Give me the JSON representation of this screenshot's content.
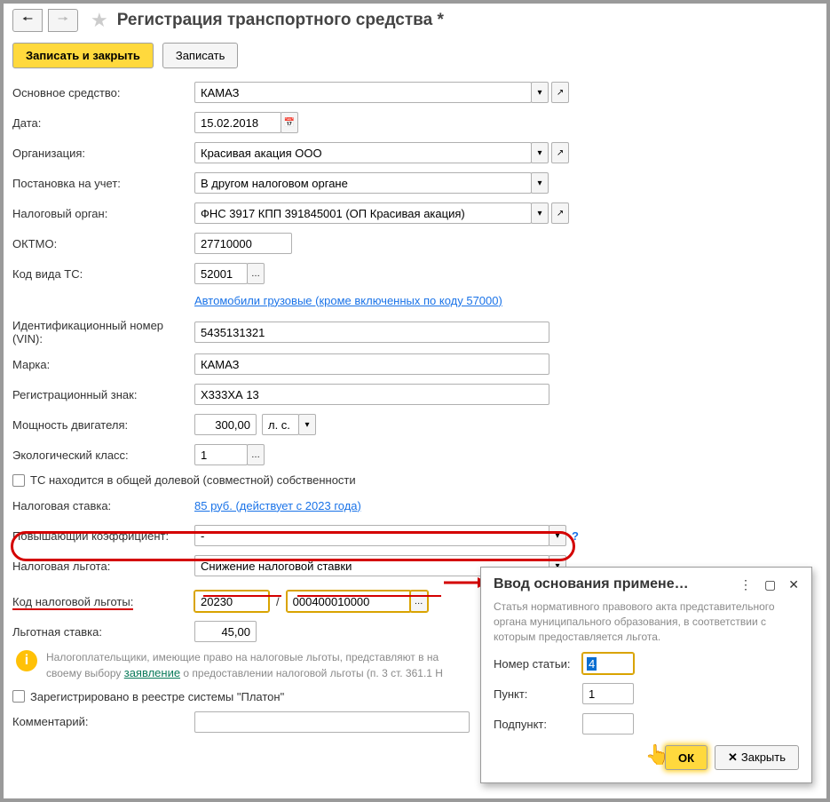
{
  "title": "Регистрация транспортного средства *",
  "toolbar": {
    "save_close": "Записать и закрыть",
    "save": "Записать"
  },
  "labels": {
    "asset": "Основное средство:",
    "date": "Дата:",
    "org": "Организация:",
    "reg": "Постановка на учет:",
    "tax_auth": "Налоговый орган:",
    "oktmo": "ОКТМО:",
    "ts_code": "Код вида ТС:",
    "vin": "Идентификационный номер (VIN):",
    "brand": "Марка:",
    "regnum": "Регистрационный знак:",
    "power": "Мощность двигателя:",
    "eco": "Экологический класс:",
    "shared": "ТС находится в общей долевой (совместной) собственности",
    "rate": "Налоговая ставка:",
    "mult": "Повышающий коэффициент:",
    "benefit": "Налоговая льгота:",
    "benefit_code": "Код налоговой льготы:",
    "benefit_rate": "Льготная ставка:",
    "platon": "Зарегистрировано в реестре системы \"Платон\"",
    "comment": "Комментарий:"
  },
  "fields": {
    "asset": "КАМАЗ",
    "date": "15.02.2018",
    "org": "Красивая акация ООО",
    "reg": "В другом налоговом органе",
    "tax_auth": "ФНС 3917 КПП 391845001 (ОП Красивая акация)",
    "oktmo": "27710000",
    "ts_code": "52001",
    "ts_code_text": "Автомобили грузовые (кроме включенных по коду 57000)",
    "vin": "5435131321",
    "brand": "КАМАЗ",
    "regnum": "Х333ХА 13",
    "power": "300,00",
    "power_unit": "л. с.",
    "eco": "1",
    "rate_link": "85 руб. (действует с 2023 года)",
    "mult": "-",
    "benefit": "Снижение налоговой ставки",
    "benefit_code1": "20230",
    "benefit_code2": "000400010000",
    "benefit_rate": "45,00",
    "comment": ""
  },
  "info": {
    "text1": "Налогоплательщики, имеющие право на налоговые льготы, представляют в на",
    "text2": "своему выбору ",
    "link": "заявление",
    "text3": " о предоставлении налоговой льготы (п. 3 ст. 361.1 Н"
  },
  "popup": {
    "title": "Ввод основания примене…",
    "desc": "Статья нормативного правового акта представительного органа муниципального образования, в соответствии с которым предоставляется льгота.",
    "article_label": "Номер статьи:",
    "article": "4",
    "punkt_label": "Пункт:",
    "punkt": "1",
    "subpunkt_label": "Подпункт:",
    "subpunkt": "",
    "ok": "ОК",
    "close": "Закрыть"
  }
}
